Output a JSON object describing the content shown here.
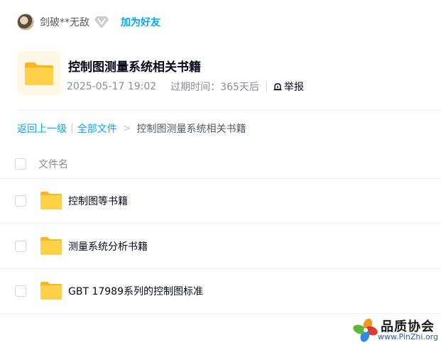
{
  "user": {
    "name": "剑破**无敌",
    "add_friend_label": "加为好友"
  },
  "share": {
    "title": "控制图测量系统相关书籍",
    "date": "2025-05-17 19:02",
    "expire_label": "过期时间：365天后",
    "report_label": "举报"
  },
  "breadcrumb": {
    "back_label": "返回上一级",
    "separator": "|",
    "all_files_label": "全部文件",
    "arrow": ">",
    "current": "控制图测量系统相关书籍"
  },
  "list": {
    "column_name": "文件名",
    "items": [
      {
        "name": "控制图等书籍",
        "icon": "folder-icon"
      },
      {
        "name": "测量系统分析书籍",
        "icon": "folder-icon"
      },
      {
        "name": "GBT 17989系列的控制图标准",
        "icon": "folder-icon"
      }
    ]
  },
  "watermark": {
    "title": "品质协会",
    "url": "www.PinZhi.org"
  },
  "colors": {
    "accent": "#06a7ff",
    "folder": "#ffc83d",
    "text_primary": "#03081a",
    "text_secondary": "#878c9c"
  }
}
